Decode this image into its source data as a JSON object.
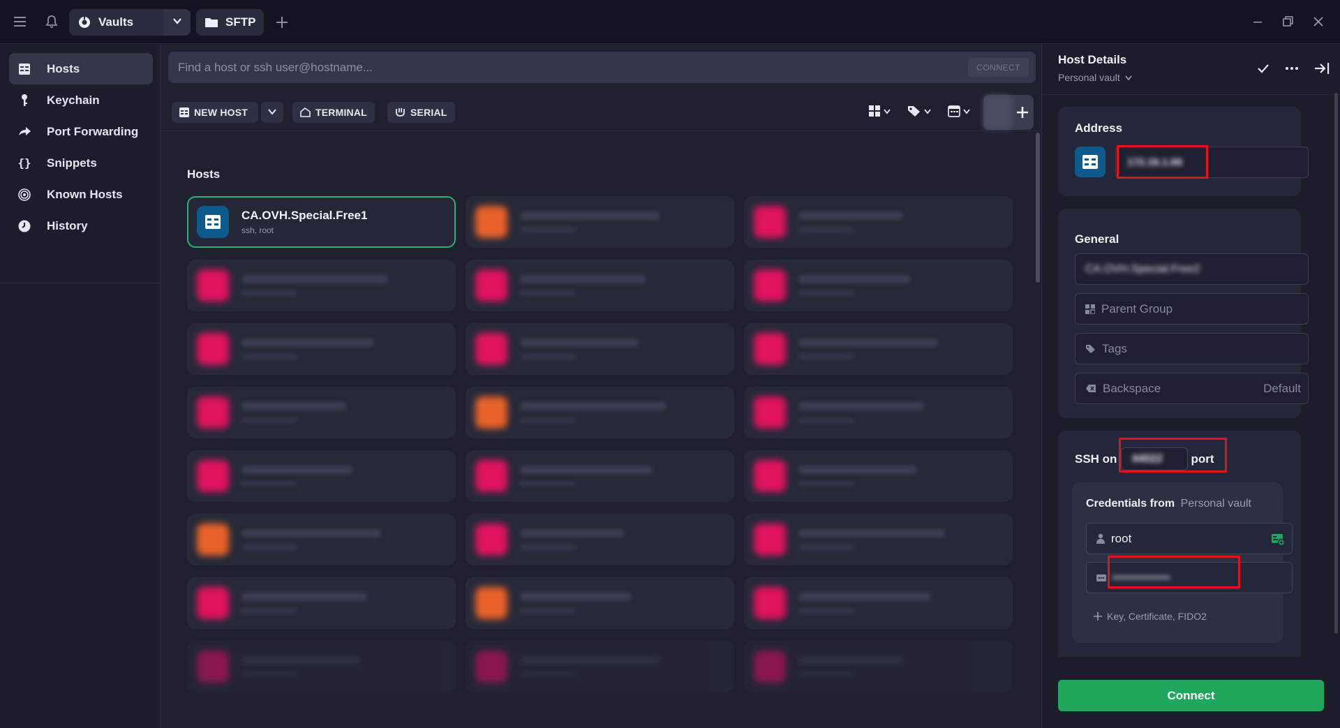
{
  "topbar": {
    "tabs": [
      {
        "label": "Vaults",
        "icon": "vault-icon"
      },
      {
        "label": "SFTP",
        "icon": "folder-icon"
      }
    ]
  },
  "sidebar": {
    "items": [
      {
        "label": "Hosts",
        "icon": "hosts-icon",
        "active": true
      },
      {
        "label": "Keychain",
        "icon": "key-icon"
      },
      {
        "label": "Port Forwarding",
        "icon": "port-forwarding-icon"
      },
      {
        "label": "Snippets",
        "icon": "braces-icon"
      },
      {
        "label": "Known Hosts",
        "icon": "fingerprint-icon"
      },
      {
        "label": "History",
        "icon": "clock-icon"
      }
    ]
  },
  "search": {
    "placeholder": "Find a host or ssh user@hostname...",
    "connect_label": "CONNECT"
  },
  "toolbar": {
    "new_host": "NEW HOST",
    "terminal": "TERMINAL",
    "serial": "SERIAL"
  },
  "hosts": {
    "title": "Hosts",
    "selected": {
      "name": "CA.OVH.Special.Free1",
      "sub": "ssh, root"
    }
  },
  "host_details": {
    "title": "Host Details",
    "vault": "Personal vault",
    "address_label": "Address",
    "address_value": "172.16.1.66",
    "general_label": "General",
    "label_value": "CA.OVH.Special.Free2",
    "parent_group_placeholder": "Parent Group",
    "tags_placeholder": "Tags",
    "backspace_label": "Backspace",
    "backspace_default": "Default",
    "ssh_on": "SSH on",
    "port_value": "44022",
    "port_suffix": "port",
    "credentials_from": "Credentials from",
    "credentials_vault": "Personal vault",
    "username": "root",
    "password_masked": "••••••••••••",
    "add_key_label": "Key, Certificate, FIDO2",
    "connect_label": "Connect"
  },
  "colors": {
    "accent_green": "#1fa85d",
    "highlight_red": "#e3121c",
    "host_pink": "#e0135f",
    "host_orange": "#e9622a",
    "selected_icon_blue": "#0e5a8c"
  }
}
